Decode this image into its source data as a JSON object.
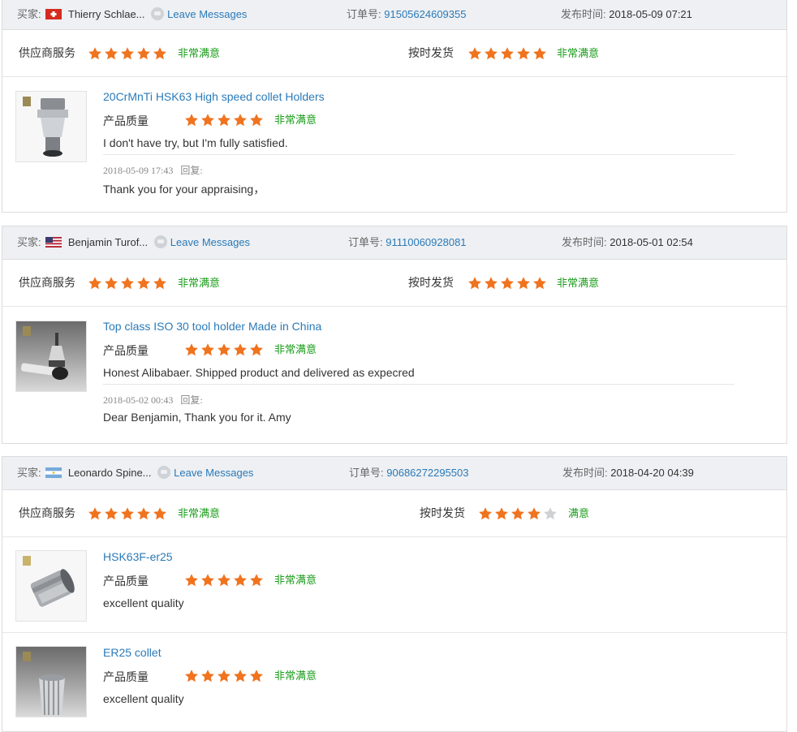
{
  "labels": {
    "buyer": "买家:",
    "leave_messages": "Leave Messages",
    "order_no": "订单号:",
    "published": "发布时间:",
    "supplier_service": "供应商服务",
    "on_time_delivery": "按时发货",
    "product_quality": "产品质量",
    "reply": "回复:"
  },
  "colors": {
    "star_on": "#f0731e",
    "star_off": "#cfd1d4",
    "satisfaction": "#1a9c1a",
    "link": "#2a7ab8"
  },
  "reviews": [
    {
      "buyer_name": "Thierry Schlae...",
      "flag": "switzerland-flag",
      "order_no": "91505624609355",
      "published": "2018-05-09 07:21",
      "supplier_rating": 5,
      "supplier_text": "非常满意",
      "delivery_rating": 5,
      "delivery_text": "非常满意",
      "items": [
        {
          "product": "20CrMnTi HSK63 High speed collet Holders",
          "quality_rating": 5,
          "quality_text": "非常满意",
          "review": "I don't have try, but I'm fully satisfied.",
          "reply_date": "2018-05-09 17:43",
          "reply": "Thank you for your appraising，"
        }
      ]
    },
    {
      "buyer_name": "Benjamin Turof...",
      "flag": "usa-flag",
      "order_no": "91110060928081",
      "published": "2018-05-01 02:54",
      "supplier_rating": 5,
      "supplier_text": "非常满意",
      "delivery_rating": 5,
      "delivery_text": "非常满意",
      "items": [
        {
          "product": "Top class ISO 30 tool holder Made in China",
          "quality_rating": 5,
          "quality_text": "非常满意",
          "review": "Honest Alibabaer. Shipped product and delivered as expecred",
          "reply_date": "2018-05-02 00:43",
          "reply": "Dear Benjamin, Thank you for it. Amy"
        }
      ]
    },
    {
      "buyer_name": "Leonardo Spine...",
      "flag": "argentina-flag",
      "order_no": "90686272295503",
      "published": "2018-04-20 04:39",
      "supplier_rating": 5,
      "supplier_text": "非常满意",
      "delivery_rating": 4,
      "delivery_text": "满意",
      "items": [
        {
          "product": "HSK63F-er25",
          "quality_rating": 5,
          "quality_text": "非常满意",
          "review": "excellent quality"
        },
        {
          "product": "ER25 collet",
          "quality_rating": 5,
          "quality_text": "非常满意",
          "review": "excellent quality"
        }
      ]
    }
  ]
}
